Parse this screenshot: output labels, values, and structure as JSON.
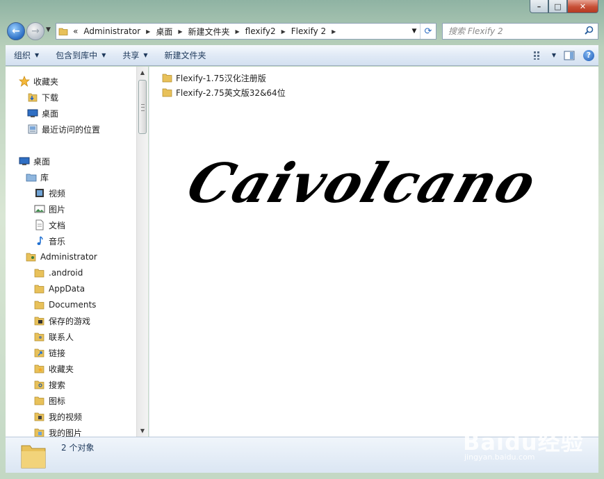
{
  "window": {
    "caption": {
      "minimize": "–",
      "maximize": "□",
      "close": "✕"
    }
  },
  "nav": {
    "breadcrumb_prefix": "«",
    "breadcrumbs": [
      "Administrator",
      "桌面",
      "新建文件夹",
      "flexify2",
      "Flexify 2"
    ],
    "search_placeholder": "搜索 Flexify 2"
  },
  "toolbar": {
    "organize": "组织",
    "include_in_library": "包含到库中",
    "share": "共享",
    "new_folder": "新建文件夹",
    "help": "?"
  },
  "sidebar": {
    "favorites": {
      "label": "收藏夹",
      "items": [
        "下载",
        "桌面",
        "最近访问的位置"
      ]
    },
    "desktop": "桌面",
    "library": {
      "label": "库",
      "items": [
        "视频",
        "图片",
        "文档",
        "音乐"
      ]
    },
    "user": {
      "label": "Administrator",
      "items": [
        ".android",
        "AppData",
        "Documents",
        "保存的游戏",
        "联系人",
        "链接",
        "收藏夹",
        "搜索",
        "图标",
        "我的视频",
        "我的图片"
      ]
    }
  },
  "files": [
    "Flexify-1.75汉化注册版",
    "Flexify-2.75英文版32&64位"
  ],
  "watermark_text": "Caivolcano",
  "status": {
    "item_count": "2 个对象"
  },
  "baidu": {
    "logo": "Baidu经验",
    "url": "jingyan.baidu.com"
  },
  "icons": {
    "folder": "folder-icon",
    "star": "star-icon",
    "download": "download-icon",
    "desktop": "desktop-icon",
    "recent": "recent-places-icon",
    "library": "library-icon",
    "video": "video-icon",
    "picture": "picture-icon",
    "document": "document-icon",
    "music": "music-icon",
    "user": "user-folder-icon"
  }
}
